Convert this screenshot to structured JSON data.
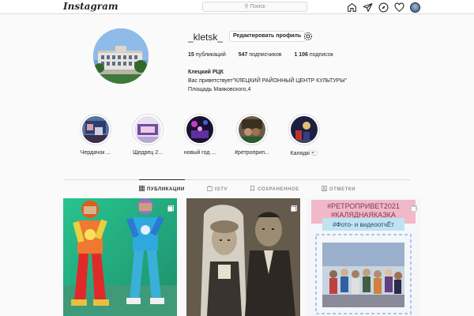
{
  "app": {
    "logo": "Instagram"
  },
  "search": {
    "placeholder": "Поиск",
    "icon": "search-icon"
  },
  "nav": {
    "icons": [
      "home-icon",
      "direct-icon",
      "explore-icon",
      "activity-heart-icon",
      "profile-avatar-icon"
    ]
  },
  "profile": {
    "username": "_kletsk_",
    "edit_button": "Редактировать профиль",
    "settings_icon": "gear-icon",
    "stats": {
      "posts_count": "15",
      "posts_label": "публикаций",
      "followers_count": "547",
      "followers_label": "подписчиков",
      "following_count": "1 106",
      "following_label": "подписок"
    },
    "bio": {
      "name": "Клецкий РЦК",
      "line1": "Вас приветствует\"КЛЕЦКИЙ РАЙОННЫЙ ЦЕНТР КУЛЬТУРЫ\"",
      "line2": "Площадь Маяковского,4"
    }
  },
  "highlights": [
    {
      "label": "Чердачок ..."
    },
    {
      "label": "Щедрец 2..."
    },
    {
      "label": "новый год ..."
    },
    {
      "label": "#ретроприп..."
    },
    {
      "label": "Калядкі 🐑"
    }
  ],
  "tabs": [
    {
      "label": "ПУБЛИКАЦИИ",
      "icon": "grid-icon",
      "active": true
    },
    {
      "label": "IGTV",
      "icon": "igtv-icon",
      "active": false
    },
    {
      "label": "СОХРАНЕННОЕ",
      "icon": "bookmark-icon",
      "active": false
    },
    {
      "label": "ОТМЕТКИ",
      "icon": "tag-icon",
      "active": false
    }
  ],
  "posts": [
    {
      "type": "multi"
    },
    {
      "type": "multi"
    },
    {
      "type": "multi",
      "text1": "#РЕТРОПРИВЕТ2021",
      "text2": "#КАЛЯДНАЯКАЗКА",
      "text3": "#Фото- и видеоотчЁт"
    }
  ],
  "colors": {
    "accent": "#262626",
    "border": "#dbdbdb",
    "muted": "#8e8e8e",
    "background": "#fafafa"
  }
}
